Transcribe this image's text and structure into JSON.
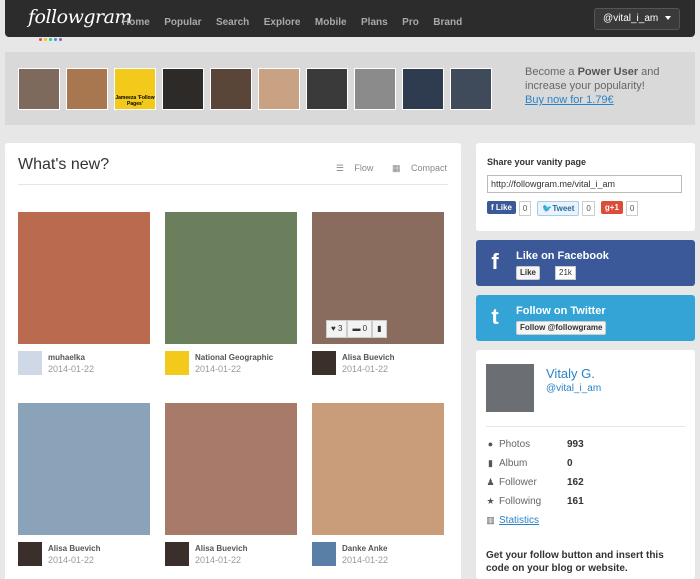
{
  "header": {
    "logo": "followgram",
    "nav": [
      "Home",
      "Popular",
      "Search",
      "Explore",
      "Mobile",
      "Plans",
      "Pro",
      "Brand"
    ],
    "user_button": "@vital_i_am"
  },
  "strip": {
    "avatars": [
      {
        "color": "#7d6a5c"
      },
      {
        "color": "#a8764f"
      },
      {
        "color": "#f3c91b",
        "text": "Jameeza 'Follow Pages'"
      },
      {
        "color": "#2e2a28"
      },
      {
        "color": "#5a4638"
      },
      {
        "color": "#c9a283"
      },
      {
        "color": "#3a3a3a"
      },
      {
        "color": "#8b8b8b"
      },
      {
        "color": "#2f3b4f"
      },
      {
        "color": "#3f4a5a"
      }
    ],
    "promo_pre": "Become a ",
    "promo_bold": "Power User",
    "promo_post": " and increase your popularity!",
    "promo_link": "Buy now for 1.79€"
  },
  "main": {
    "title": "What's new?",
    "view_flow": "Flow",
    "view_compact": "Compact",
    "photos": [
      {
        "user": "muhaelka",
        "date": "2014-01-22",
        "color": "#b96a4f",
        "thumb": "#cfd8e6"
      },
      {
        "user": "National Geographic",
        "date": "2014-01-22",
        "color": "#6c7f5c",
        "thumb": "#f3c91b"
      },
      {
        "user": "Alisa Buevich",
        "date": "2014-01-22",
        "color": "#8a6c5f",
        "thumb": "#3a2f2a",
        "likes": "3",
        "comments": "0"
      },
      {
        "user": "Alisa Buevich",
        "date": "2014-01-22",
        "color": "#8aa3b9",
        "thumb": "#3a2f2a"
      },
      {
        "user": "Alisa Buevich",
        "date": "2014-01-22",
        "color": "#a77a6a",
        "thumb": "#3a2f2a"
      },
      {
        "user": "Danke Anke",
        "date": "2014-01-22",
        "color": "#c99d7a",
        "thumb": "#5a7fa6"
      }
    ]
  },
  "share": {
    "title": "Share your vanity page",
    "url": "http://followgram.me/vital_i_am",
    "like_label": "Like",
    "like_count": "0",
    "tweet_label": "Tweet",
    "tweet_count": "0",
    "gplus_label": "+1",
    "gplus_count": "0"
  },
  "facebook": {
    "title": "Like on Facebook",
    "button": "Like",
    "count": "21k"
  },
  "twitter": {
    "title": "Follow on Twitter",
    "button": "Follow @followgrame"
  },
  "profile": {
    "name": "Vitaly G.",
    "handle": "@vital_i_am",
    "stats": [
      {
        "label": "Photos",
        "value": "993",
        "icon": "drop-icon"
      },
      {
        "label": "Album",
        "value": "0",
        "icon": "album-icon"
      },
      {
        "label": "Follower",
        "value": "162",
        "icon": "user-icon"
      },
      {
        "label": "Following",
        "value": "161",
        "icon": "star-icon"
      }
    ],
    "statistics_link": "Statistics",
    "cta": "Get your follow button and insert this code on your blog or website."
  }
}
